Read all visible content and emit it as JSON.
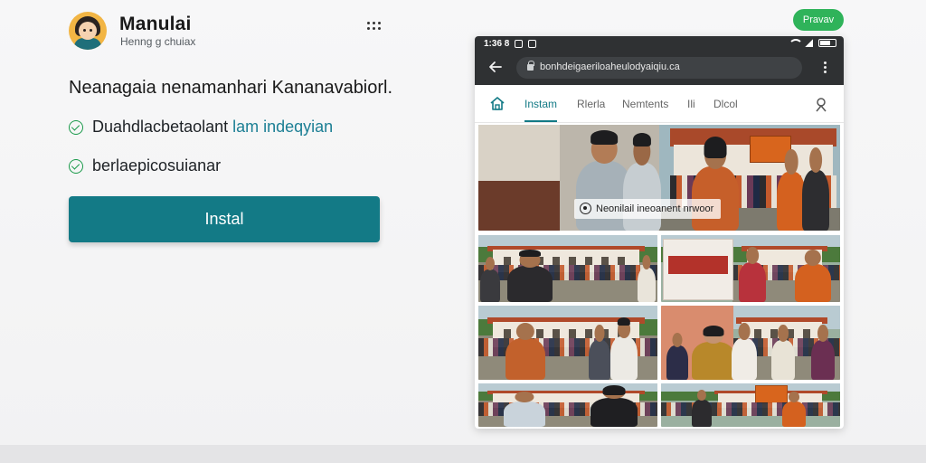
{
  "app": {
    "name": "Manulai",
    "subtitle": "Henng g chuiax"
  },
  "headline": "Neanagaia nenamanhari Kananavabiorl.",
  "features": [
    {
      "text_main": "Duahdlacbetaolant ",
      "text_highlight": "lam indeqyian"
    },
    {
      "text_main": "berlaepicosuianar",
      "text_highlight": ""
    }
  ],
  "install_label": "Instal",
  "preview_label": "Pravav",
  "phone": {
    "status": {
      "time": "1:36 8"
    },
    "url": "bonhdeigaeriloaheulodyaiqiu.ca",
    "tabs": [
      "Instam",
      "Rlerla",
      "Nemtents",
      "Ili",
      "Dlcol"
    ],
    "active_tab": 0,
    "caption": "Neonilail ineoanent nrwoor"
  },
  "colors": {
    "accent": "#137a86",
    "check": "#1a9a4a",
    "preview_pill": "#2fb35a",
    "browser_chrome": "#2f3133"
  },
  "icons": {
    "feature_bullet": "check-circle-icon",
    "menu": "kebab-menu-icon",
    "back": "back-arrow-icon",
    "lock": "lock-icon",
    "home": "home-icon",
    "profile": "person-icon"
  }
}
